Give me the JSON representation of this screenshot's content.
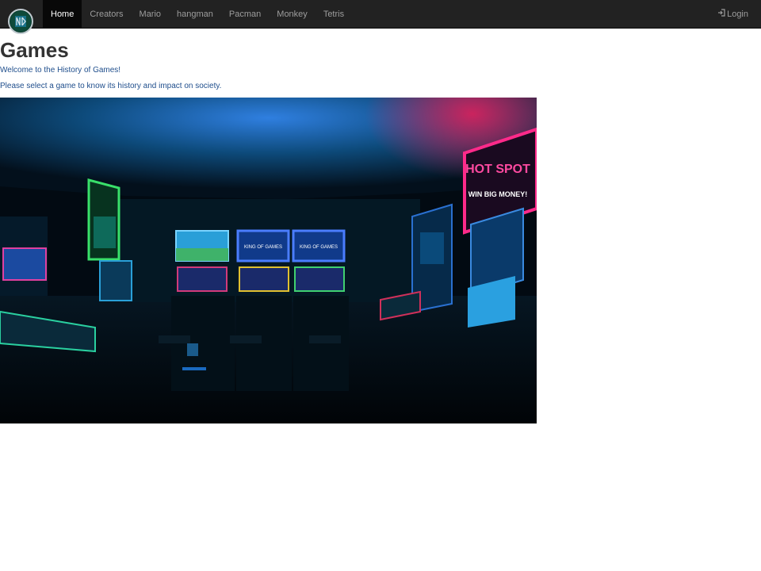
{
  "navbar": {
    "brand_icon": "site-logo-icon",
    "items": [
      {
        "label": "Home",
        "active": true
      },
      {
        "label": "Creators"
      },
      {
        "label": "Mario"
      },
      {
        "label": "hangman"
      },
      {
        "label": "Pacman"
      },
      {
        "label": "Monkey"
      },
      {
        "label": "Tetris"
      }
    ],
    "login_label": "Login",
    "login_icon": "login-icon"
  },
  "main": {
    "title": "Games",
    "welcome": "Welcome to the History of Games!",
    "instruction": "Please select a game to know its history and impact on society.",
    "hero_image_signs": [
      "KING OF GAMES",
      "KING OF GAMES",
      "HOT SPOT",
      "WIN BIG MONEY!"
    ]
  },
  "colors": {
    "navbar_bg": "#222222",
    "nav_active_bg": "#080808",
    "nav_text": "#9d9d9d",
    "link_text": "#1f4e8c",
    "heading": "#333333"
  }
}
